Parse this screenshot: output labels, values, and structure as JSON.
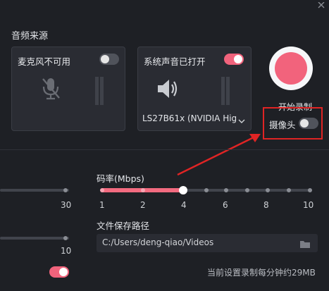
{
  "window": {
    "close_icon": "close-icon"
  },
  "audio_source": {
    "title": "音频来源",
    "mic": {
      "label": "麦克风不可用",
      "enabled": false,
      "icon": "mic-off-icon"
    },
    "system": {
      "label": "系统声音已打开",
      "enabled": true,
      "icon": "speaker-icon",
      "device": "LS27B61x (NVIDIA Hig"
    }
  },
  "record": {
    "label": "开始录制",
    "color": "#f2637c"
  },
  "camera": {
    "label": "摄像头",
    "enabled": false
  },
  "fps_slider": {
    "max_label": "30"
  },
  "bitrate": {
    "label": "码率(Mbps)",
    "ticks": [
      "1",
      "2",
      "4",
      "6",
      "8",
      "10"
    ],
    "selected": "4"
  },
  "quality_slider": {
    "max_label": "10"
  },
  "save_path": {
    "label": "文件保存路径",
    "value": "C:/Users/deng-qiao/Videos",
    "icon": "folder-icon"
  },
  "extra_toggle": {
    "enabled": true
  },
  "footer": {
    "estimate": "当前设置录制每分钟约29MB"
  },
  "annotation": {
    "box_color": "#e02424"
  }
}
